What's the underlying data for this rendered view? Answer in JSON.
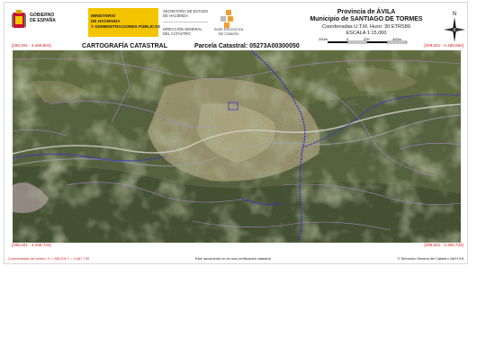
{
  "header": {
    "gobierno": [
      "GOBIERNO",
      "DE ESPAÑA"
    ],
    "ministerio": [
      "MINISTERIO",
      "DE HACIENDA",
      "Y ADMINISTRACIONES PÚBLICAS"
    ],
    "secretaria": [
      "SECRETARÍA DE ESTADO",
      "DE HACIENDA"
    ],
    "direccion": [
      "DIRECCIÓN GENERAL",
      "DEL CATASTRO"
    ],
    "sede": [
      "Sede Electrónica",
      "del Catastro"
    ],
    "province": "Provincia de ÁVILA",
    "municipality": "Municipio de SANTIAGO DE TORMES",
    "coordinates": "Coordenadas U.T.M. Huso: 30 ETRS89",
    "scale": "ESCALA 1:15,000",
    "scale_ticks": [
      "200m",
      "0",
      "200",
      "400m"
    ],
    "north_label": "N"
  },
  "titles": {
    "cartografia": "CARTOGRAFÍA CATASTRAL",
    "parcela": "Parcela Catastral: 05273A00300050"
  },
  "corners": {
    "top_left": "[296,201 - 4.468,684]",
    "top_right": "[299,601 - 4.468,684]",
    "bottom_left": "[296,201 - 4.466,734]",
    "bottom_right": "[299,601 - 4.466,734]"
  },
  "footer": {
    "center_coords": "Coordenadas del centro: X = 298,001 Y = 4,467,709",
    "disclaimer": "Este documento no es una certificación catastral",
    "copyright": "© Dirección General del Catastro 16/07/18"
  },
  "colors": {
    "boundary_line": "#3a2fc9",
    "parcel_line": "#b18ad6",
    "corner_text": "#d21e1e",
    "gov_yellow": "#f4c400"
  }
}
